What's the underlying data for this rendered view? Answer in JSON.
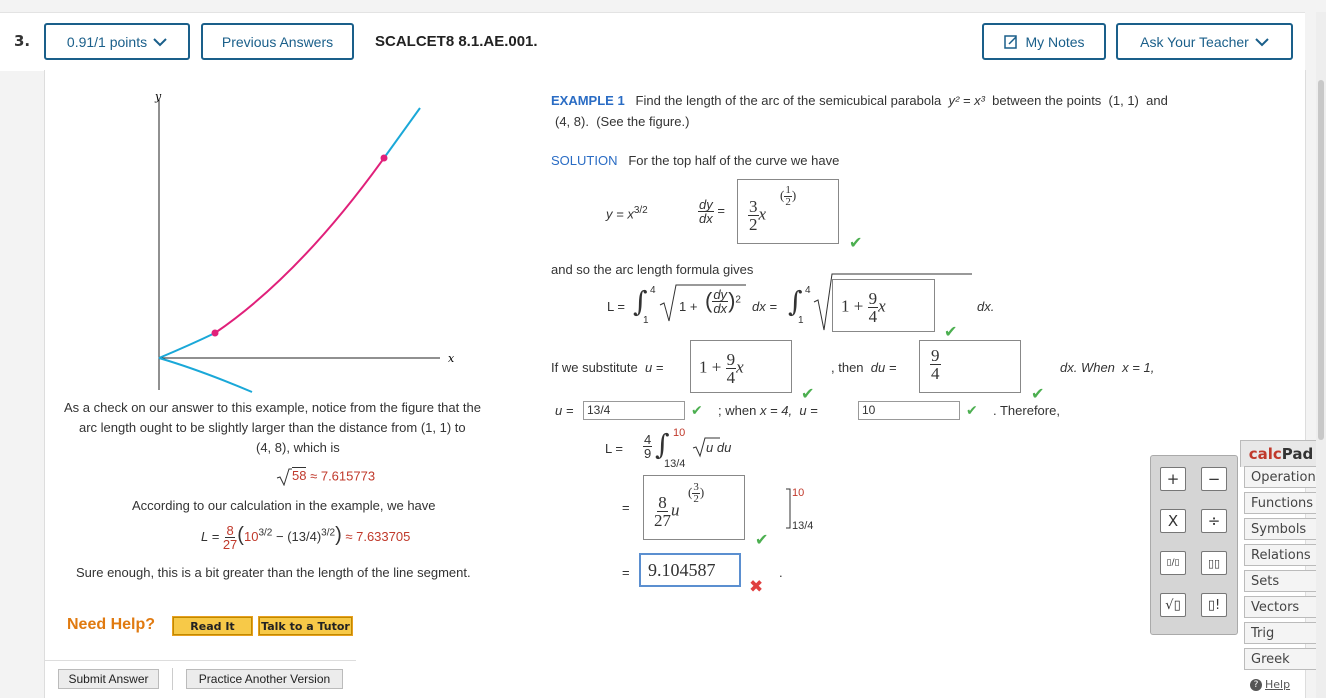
{
  "header": {
    "question_number": "3.",
    "points_label": "0.91/1 points",
    "previous_answers_label": "Previous Answers",
    "question_id": "SCALCET8 8.1.AE.001.",
    "my_notes_label": "My Notes",
    "ask_teacher_label": "Ask Your Teacher"
  },
  "graph": {
    "y_label": "y",
    "x_label": "x"
  },
  "example": {
    "label": "EXAMPLE 1",
    "text1": "Find the length of the arc of the semicubical parabola",
    "eq": "y² = x³",
    "text2": "between the points",
    "p1": "(1, 1)",
    "and": "and",
    "p2": "(4, 8).",
    "see": "(See the figure.)"
  },
  "solution": {
    "label": "SOLUTION",
    "text": "For the top half of the curve we have",
    "y_eq": "y = x",
    "y_exp": "3/2",
    "dy_num": "dy",
    "dy_den": "dx",
    "eqsign": "=",
    "deriv_coef_n": "3",
    "deriv_coef_d": "2",
    "deriv_var": "x",
    "deriv_exp_n": "1",
    "deriv_exp_d": "2",
    "arc_text": "and so the arc length formula gives",
    "L_eq": "L =",
    "lower1": "1",
    "upper4": "4",
    "one_plus": "1 +",
    "sq": "2",
    "dx_end": "dx =",
    "inner_box": "1 +",
    "nine": "9",
    "four": "4",
    "dx_dot": "dx.",
    "sub_text": "If we substitute",
    "u_eq": "u =",
    "sub_box": "1 +",
    "then": ", then",
    "du_eq": "du =",
    "du_num": "9",
    "du_den": "4",
    "when1": "dx.  When",
    "x_eq1": "x = 1,",
    "u_eq2": "u =",
    "u_val1": "13/4",
    "when4": ";  when",
    "x_eq4": "x = 4,",
    "u_eq3": "u =",
    "u_val2": "10",
    "therefore": ".  Therefore,",
    "int_coef_n": "4",
    "int_coef_d": "9",
    "upper10": "10",
    "lower134": "13/4",
    "sqrt_u": "u",
    "du": "du",
    "eq2": "=",
    "box2_n": "8",
    "box2_d": "27",
    "box2_var": "u",
    "box2_exp_n": "3",
    "box2_exp_d": "2",
    "eval_upper": "10",
    "eval_lower": "13/4",
    "eq3": "=",
    "answer": "9.104587",
    "period": "."
  },
  "check": {
    "text1": "As a check on our answer to this example, notice from the figure that the",
    "text2": "arc length ought to be slightly larger than the distance from",
    "p1": "(1, 1)",
    "to": "to",
    "p2": "(4, 8)",
    "which": ", which is",
    "sqrt_val": "58",
    "approx1": "≈ 7.615773",
    "calc_text": "According to our calculation in the example, we have",
    "L": "L =",
    "frac_n": "8",
    "frac_d": "27",
    "expr_a": "10",
    "expr_a_exp": "3/2",
    "minus": "−",
    "expr_b": "(13/4)",
    "expr_b_exp": "3/2",
    "approx2": "≈ 7.633705",
    "sure": "Sure enough, this is a bit greater than the length of the line segment."
  },
  "help": {
    "need_help": "Need Help?",
    "read_it": "Read It",
    "talk_tutor": "Talk to a Tutor"
  },
  "footer": {
    "submit": "Submit Answer",
    "practice": "Practice Another Version"
  },
  "calcpad": {
    "title_a": "calc",
    "title_b": "Pad",
    "tabs": [
      "Operations",
      "Functions",
      "Symbols",
      "Relations",
      "Sets",
      "Vectors",
      "Trig",
      "Greek"
    ],
    "help": "Help",
    "keys": [
      "+",
      "−",
      "X",
      "÷",
      "▯/▯",
      "▯▯",
      "√▯",
      "▯!"
    ]
  },
  "colors": {
    "curve_top": "#e0207a",
    "curve_bottom": "#1aa8d8",
    "accent": "#1a5f8a"
  }
}
